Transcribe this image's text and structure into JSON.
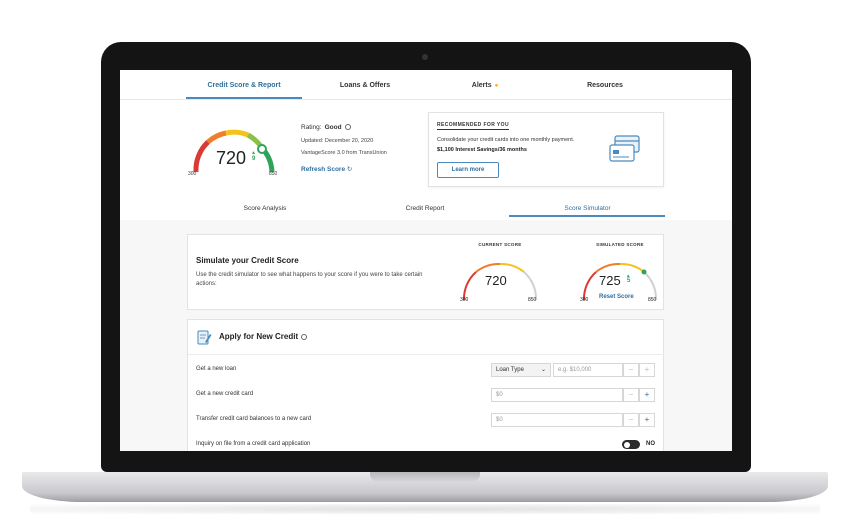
{
  "nav": {
    "tabs": [
      {
        "label": "Credit Score & Report",
        "active": true
      },
      {
        "label": "Loans & Offers"
      },
      {
        "label": "Alerts",
        "dot": "●"
      },
      {
        "label": "Resources"
      }
    ]
  },
  "score": {
    "value": "720",
    "change": "9",
    "min": "300",
    "max": "850",
    "rating_label": "Rating:",
    "rating_value": "Good",
    "updated": "Updated: December 20, 2020",
    "model_prefix": "VantageScore 3.0 from",
    "model_source": "TransUnion",
    "refresh_label": "Refresh Score",
    "gauge_level": 0.82
  },
  "recommended": {
    "title": "RECOMMENDED FOR YOU",
    "body": "Consolidate your credit cards into one monthly payment.",
    "highlight": "$1,100 Interest Savings/36 months",
    "button": "Learn more",
    "icon": "credit-card-icon"
  },
  "subtabs": [
    {
      "label": "Score Analysis"
    },
    {
      "label": "Credit Report"
    },
    {
      "label": "Score Simulator",
      "active": true
    }
  ],
  "simulator": {
    "title": "Simulate your Credit Score",
    "description": "Use the credit simulator to see what happens to your score if you were to take certain actions:",
    "current": {
      "label": "CURRENT SCORE",
      "value": "720",
      "min": "300",
      "max": "850",
      "gauge_level": 0.78
    },
    "simulated": {
      "label": "SIMULATED SCORE",
      "value": "725",
      "change": "5",
      "min": "300",
      "max": "850",
      "reset": "Reset Score",
      "gauge_level": 0.8
    }
  },
  "apply": {
    "title": "Apply for New Credit",
    "rows": [
      {
        "label": "Get a new loan",
        "select": "Loan Type",
        "placeholder": "e.g. $10,000"
      },
      {
        "label": "Get a new credit card",
        "placeholder": "$0"
      },
      {
        "label": "Transfer credit card balances to a new card",
        "placeholder": "$0"
      },
      {
        "label": "Inquiry on file from a credit card application",
        "toggle": "NO"
      }
    ]
  },
  "colors": {
    "accent": "#2f6f9f",
    "alert": "#f5a623",
    "gauge_red": "#d93a35",
    "gauge_yellow": "#f3c21b",
    "gauge_green": "#2fa35a"
  }
}
